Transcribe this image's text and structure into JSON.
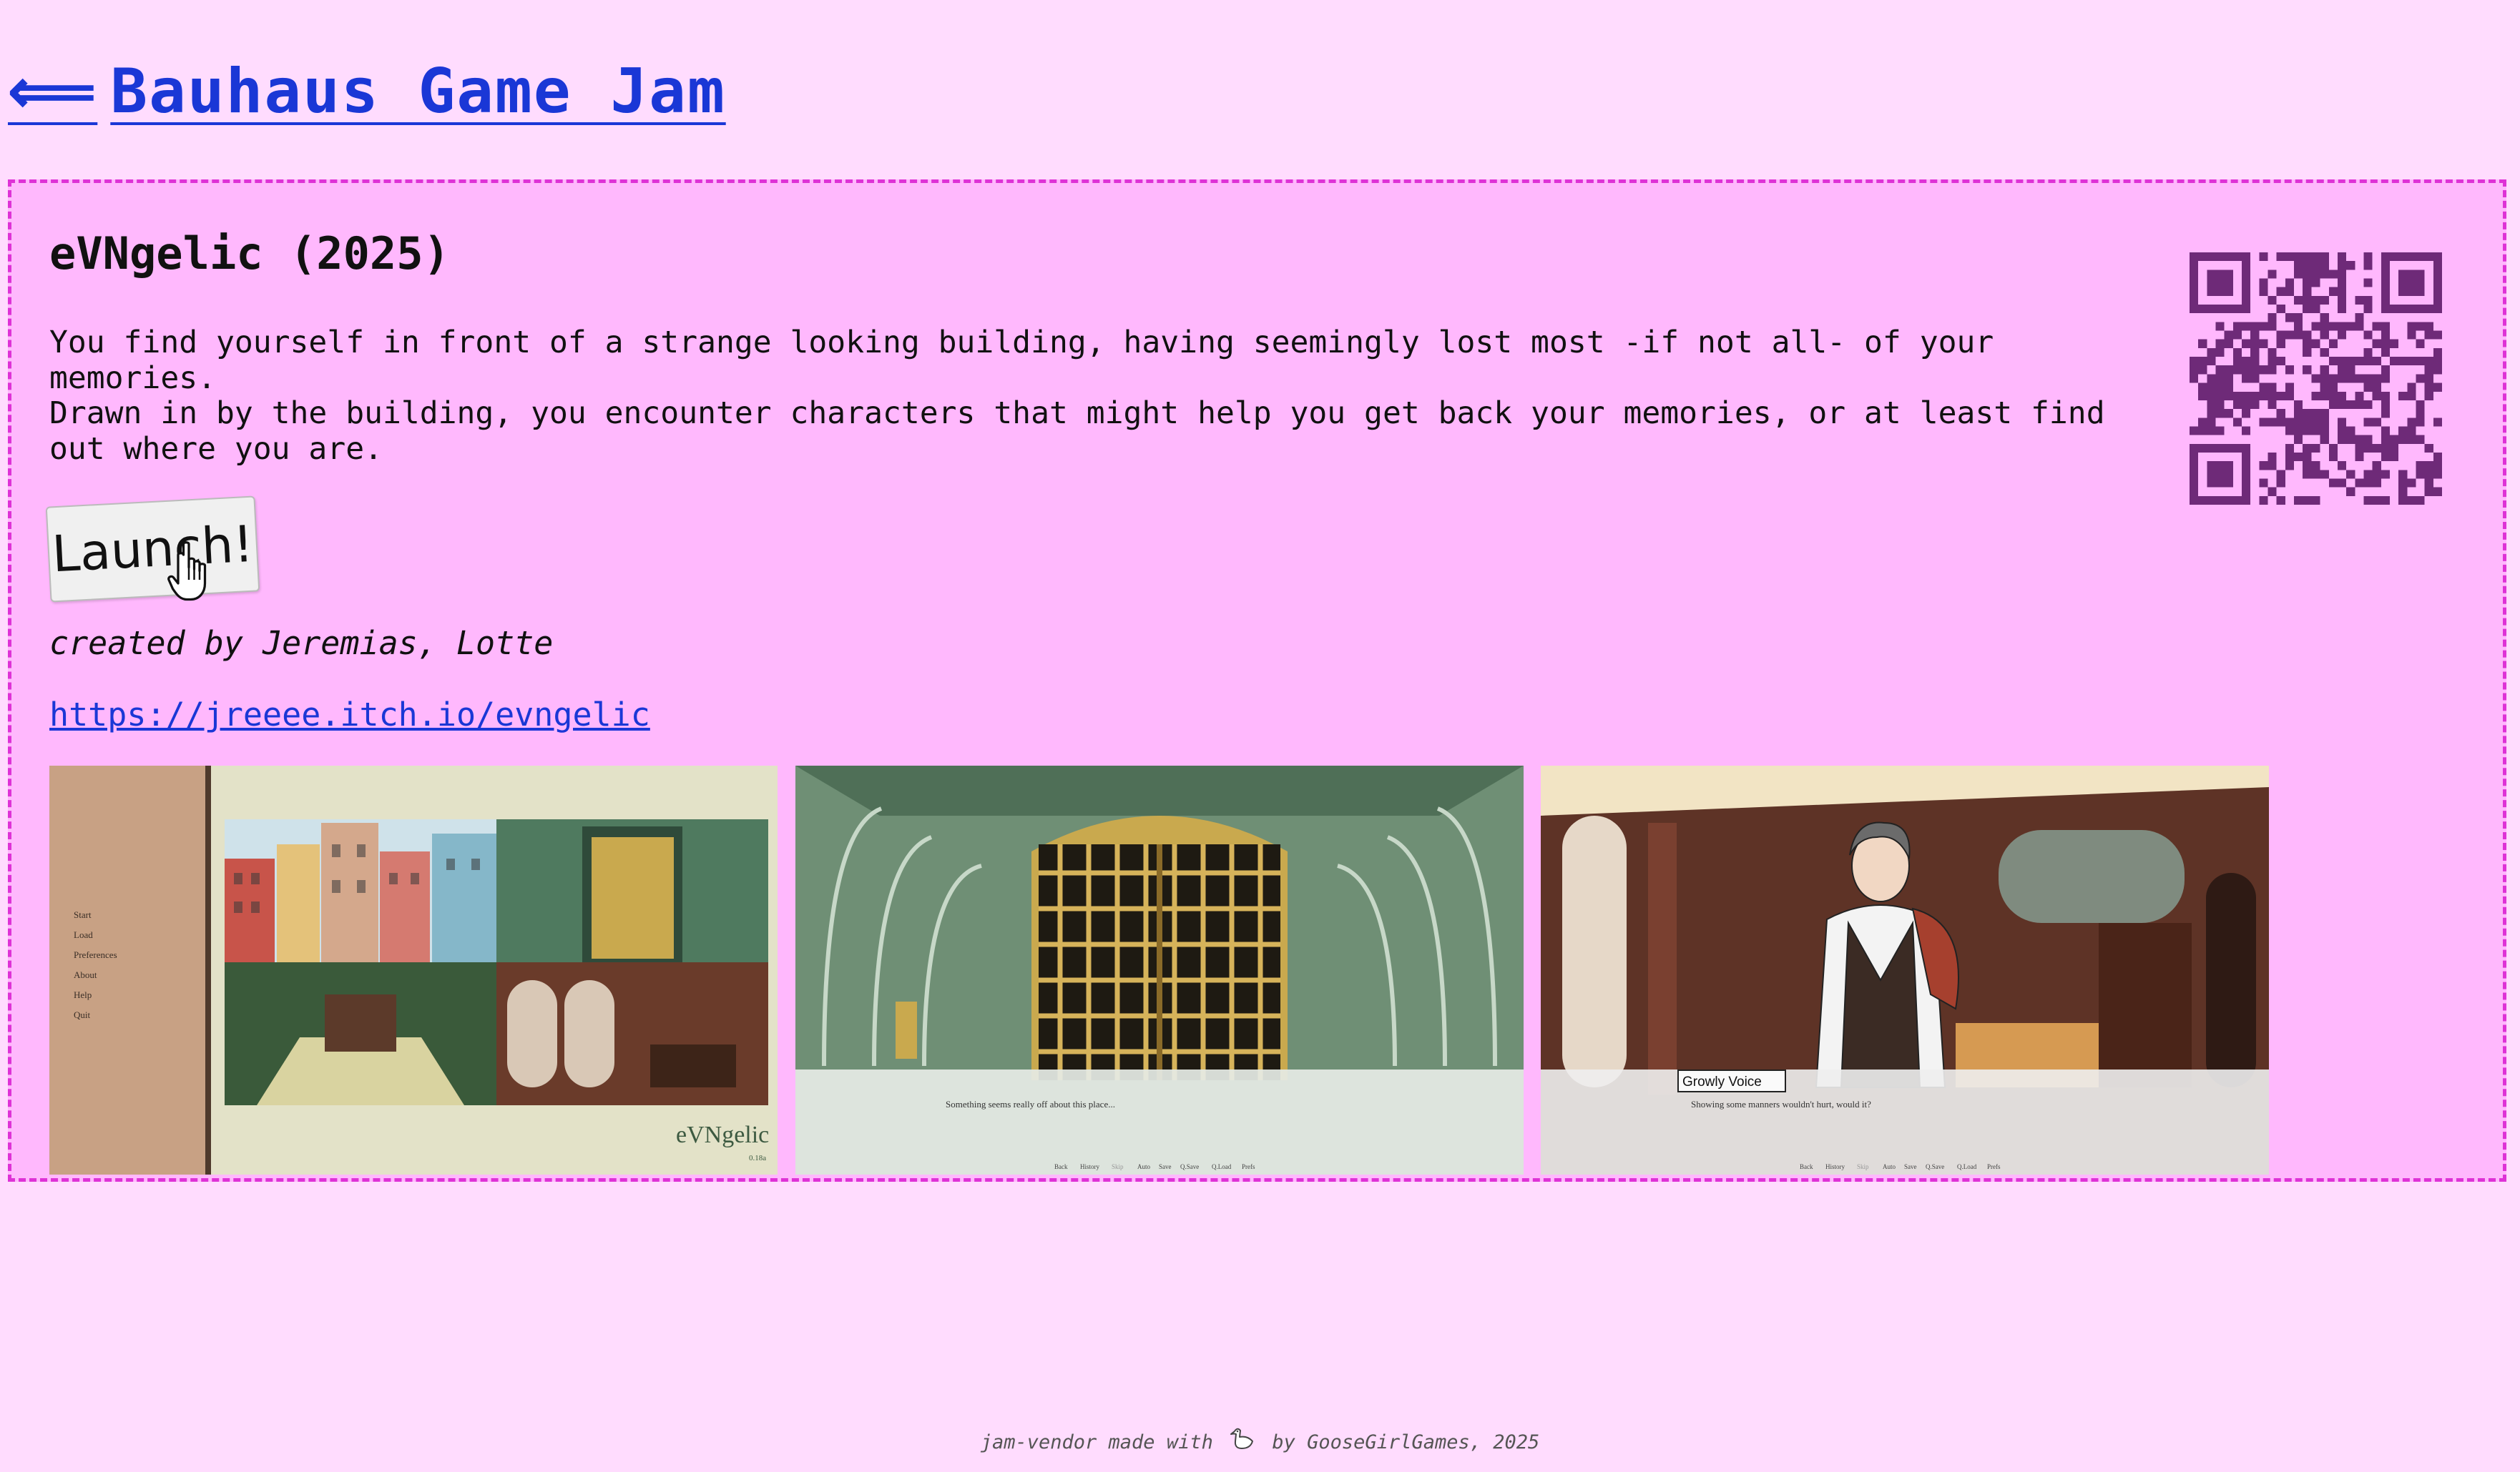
{
  "header": {
    "back_arrow": "⟸",
    "back_label": "Bauhaus Game Jam"
  },
  "game": {
    "title": "eVNgelic (2025)",
    "description_1": "You find yourself in front of a strange looking building, having seemingly lost most -if not all- of your memories.",
    "description_2": "Drawn in by the building, you encounter characters that might help you get back your memories, or at least find out where you are.",
    "launch_label": "Launch!",
    "created_by": "created by Jeremias, Lotte",
    "url": "https://jreeee.itch.io/evngelic"
  },
  "screenshots": [
    {
      "menu_items": [
        "Start",
        "Load",
        "Preferences",
        "About",
        "Help",
        "Quit"
      ],
      "logo": "eVNgelic",
      "version": "0.18a"
    },
    {
      "dialogue": "Something seems really off about this place...",
      "controls": [
        "Back",
        "History",
        "Skip",
        "Auto",
        "Save",
        "Q.Save",
        "Q.Load",
        "Prefs"
      ]
    },
    {
      "speaker": "Growly Voice",
      "dialogue": "Showing some manners wouldn't hurt, would it?",
      "controls": [
        "Back",
        "History",
        "Skip",
        "Auto",
        "Save",
        "Q.Save",
        "Q.Load",
        "Prefs"
      ]
    }
  ],
  "footer": {
    "before": "jam-vendor made with",
    "after": "by GooseGirlGames, 2025"
  },
  "icons": {
    "back": "left-double-arrow-icon",
    "cursor": "hand-pointer-icon",
    "qr": "qr-code-icon",
    "footer": "goose-icon"
  },
  "colors": {
    "page_bg": "#ffdcfe",
    "card_bg": "#ffb8fd",
    "card_border": "#de32d6",
    "link": "#1a37d6",
    "qr": "#6e2a78"
  }
}
